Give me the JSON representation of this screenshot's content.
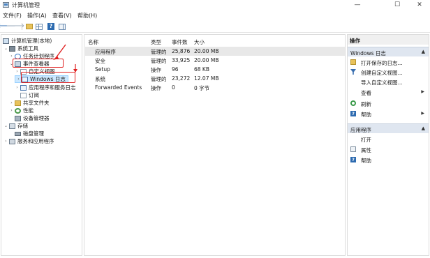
{
  "window": {
    "title": "计算机管理",
    "minimize_glyph": "—",
    "maximize_glyph": "☐",
    "close_glyph": "✕"
  },
  "menu": [
    "文件(F)",
    "操作(A)",
    "查看(V)",
    "帮助(H)"
  ],
  "toolbar": {
    "back_icon": "arrow-left-icon",
    "forward_icon": "arrow-right-icon",
    "back_glyph": "🡐",
    "forward_glyph": "🡒",
    "help_glyph": "?"
  },
  "tree": {
    "root": "计算机管理(本地)",
    "system_tools": "系统工具",
    "task_scheduler": "任务计划程序",
    "event_viewer": "事件查看器",
    "custom_views": "自定义视图",
    "windows_logs": "Windows 日志",
    "app_service_logs": "应用程序和服务日志",
    "subscriptions": "订阅",
    "shared_folders": "共享文件夹",
    "performance": "性能",
    "device_manager": "设备管理器",
    "storage": "存储",
    "disk_management": "磁盘管理",
    "services_apps": "服务和应用程序",
    "expanded_glyph": "⌄",
    "collapsed_glyph": "›"
  },
  "list": {
    "columns": [
      "名称",
      "类型",
      "事件数",
      "大小"
    ],
    "rows": [
      {
        "name": "应用程序",
        "type": "管理的",
        "count": "25,876",
        "size": "20.00 MB"
      },
      {
        "name": "安全",
        "type": "管理的",
        "count": "33,925",
        "size": "20.00 MB"
      },
      {
        "name": "Setup",
        "type": "操作",
        "count": "96",
        "size": "68 KB"
      },
      {
        "name": "系统",
        "type": "管理的",
        "count": "23,272",
        "size": "12.07 MB"
      },
      {
        "name": "Forwarded Events",
        "type": "操作",
        "count": "0",
        "size": "0 字节"
      }
    ]
  },
  "actions": {
    "header": "操作",
    "section1": {
      "title": "Windows 日志",
      "items": [
        "打开保存的日志...",
        "创建自定义视图...",
        "导入自定义视图...",
        "查看",
        "刷新",
        "帮助"
      ]
    },
    "section2": {
      "title": "应用程序",
      "items": [
        "打开",
        "属性",
        "帮助"
      ]
    },
    "collapse_glyph": "▲",
    "submenu_glyph": "▶"
  },
  "colors": {
    "annotation": "#e02020",
    "selection": "#cce8ff",
    "section_header": "#dfe6f0"
  }
}
